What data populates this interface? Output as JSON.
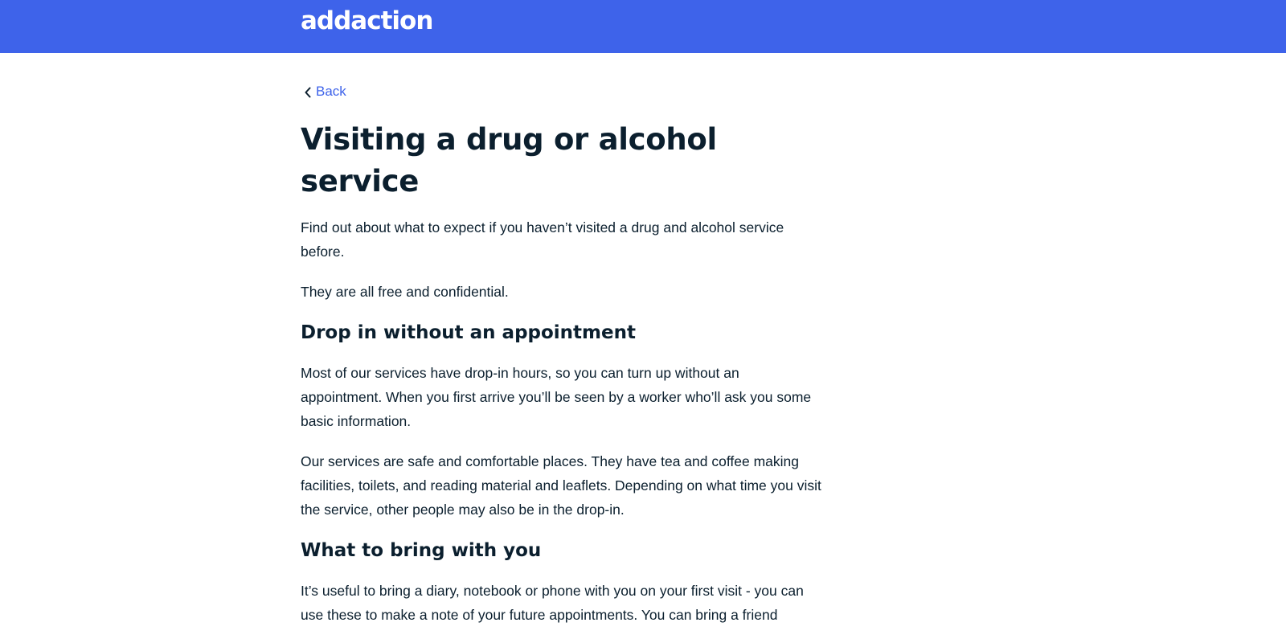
{
  "header": {
    "logo_text": "addaction",
    "background": "#3e63ea"
  },
  "nav": {
    "back_label": "Back"
  },
  "page": {
    "title": "Visiting a drug or alcohol service",
    "intro": [
      "Find out about what to expect if you haven’t visited a drug and alcohol service before.",
      "They are all free and confidential."
    ],
    "sections": [
      {
        "heading": "Drop in without an appointment",
        "paragraphs": [
          "Most of our services have drop-in hours, so you can turn up without an appointment. When you first arrive you’ll be seen by a worker who’ll ask you some basic information.",
          "Our services are safe and comfortable places. They have tea and coffee making facilities, toilets, and reading material and leaflets. Depending on what time you visit the service, other people may also be in the drop-in."
        ]
      },
      {
        "heading": "What to bring with you",
        "paragraphs": [
          "It’s useful to bring a diary, notebook or phone with you on your first visit - you can use these to make a note of your future appointments. You can bring a friend"
        ]
      }
    ]
  }
}
